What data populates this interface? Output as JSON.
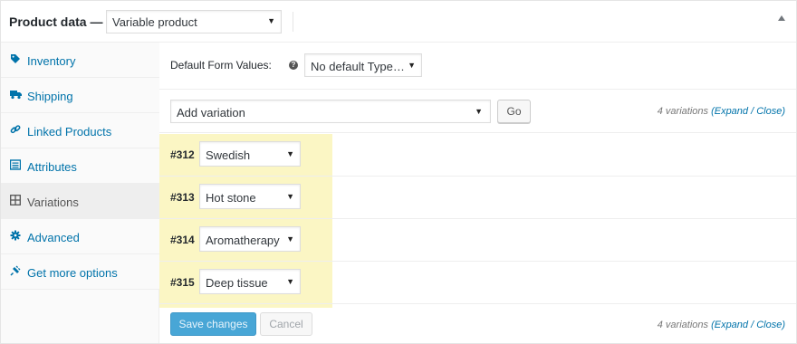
{
  "header": {
    "title": "Product data —",
    "product_type": "Variable product"
  },
  "sidebar": {
    "items": [
      {
        "label": "Inventory",
        "icon": "tag-icon"
      },
      {
        "label": "Shipping",
        "icon": "truck-icon"
      },
      {
        "label": "Linked Products",
        "icon": "link-icon"
      },
      {
        "label": "Attributes",
        "icon": "list-icon"
      },
      {
        "label": "Variations",
        "icon": "grid-icon",
        "active": true
      },
      {
        "label": "Advanced",
        "icon": "gear-icon"
      },
      {
        "label": "Get more options",
        "icon": "plugin-icon"
      }
    ]
  },
  "defaults": {
    "label": "Default Form Values:",
    "help": "?",
    "value": "No default Type…"
  },
  "add_variation": {
    "value": "Add variation",
    "go_label": "Go",
    "count_prefix": "4 variations ",
    "count_links": "(Expand / Close)"
  },
  "variations": [
    {
      "id": "#312",
      "value": "Swedish"
    },
    {
      "id": "#313",
      "value": "Hot stone"
    },
    {
      "id": "#314",
      "value": "Aromatherapy"
    },
    {
      "id": "#315",
      "value": "Deep tissue"
    }
  ],
  "footer": {
    "save_label": "Save changes",
    "cancel_label": "Cancel",
    "count_prefix": "4 variations ",
    "count_links": "(Expand / Close)"
  },
  "colors": {
    "link": "#0073aa",
    "highlight": "#fbf6c4",
    "primary_button": "#48a6d6"
  }
}
